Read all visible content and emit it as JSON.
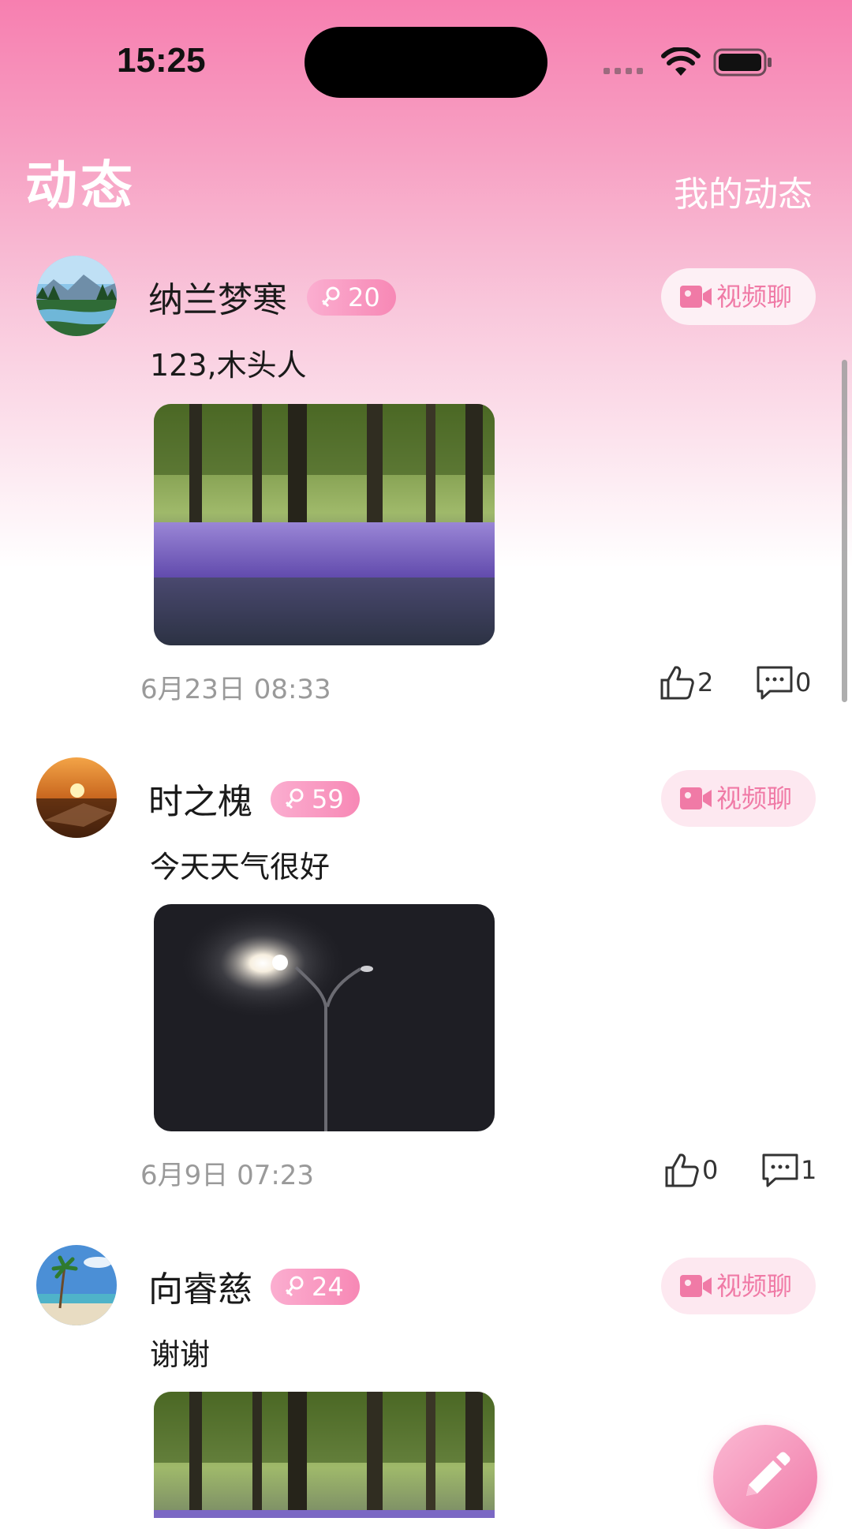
{
  "status_bar": {
    "time": "15:25"
  },
  "header": {
    "title": "动态",
    "my_posts_label": "我的动态"
  },
  "accent_color": "#f07aa6",
  "posts": [
    {
      "username": "纳兰梦寒",
      "badge_age": "20",
      "badge_icon": "female-icon",
      "video_chat_label": "视频聊",
      "content": "123,木头人",
      "photo": "forest-lavender-photo",
      "time": "6月23日 08:33",
      "likes": "2",
      "comments": "0"
    },
    {
      "username": "时之槐",
      "badge_age": "59",
      "badge_icon": "female-icon",
      "video_chat_label": "视频聊",
      "content": "今天天气很好",
      "photo": "street-lamp-photo",
      "time": "6月9日 07:23",
      "likes": "0",
      "comments": "1"
    },
    {
      "username": "向睿慈",
      "badge_age": "24",
      "badge_icon": "female-icon",
      "video_chat_label": "视频聊",
      "content": "谢谢",
      "photo": "forest-lavender-photo",
      "time": "",
      "likes": "",
      "comments": ""
    }
  ],
  "fab_icon": "pencil-icon"
}
